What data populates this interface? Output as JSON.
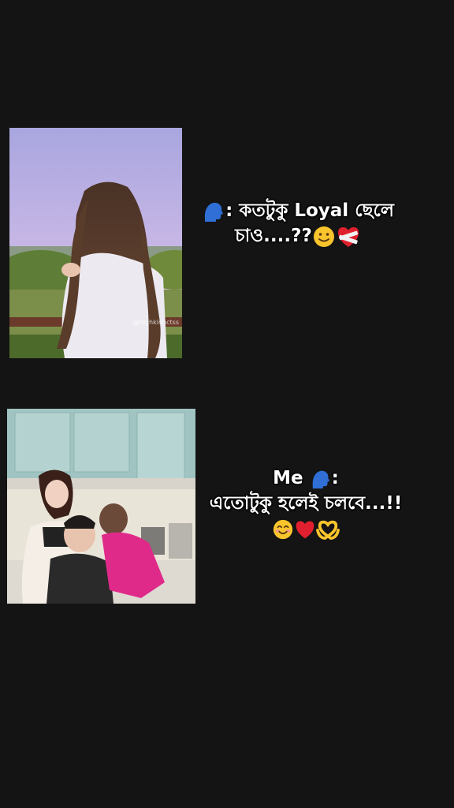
{
  "post": {
    "top": {
      "caption_line1": "কতটুকু Loyal ছেলে",
      "caption_line2": "চাও....??",
      "image_watermark": "@highkinnctss"
    },
    "bottom": {
      "caption_prefix": "Me",
      "caption_line2": "এতোটুকু হলেই চলবে...!!"
    }
  },
  "emoji": {
    "speaking_head": "speaking-head-icon",
    "slight_smile": "slightly-smiling-face-icon",
    "bandaged_heart": "bandaged-heart-icon",
    "smiling_blush": "smiling-face-icon",
    "red_heart": "red-heart-icon",
    "heart_hands": "heart-hands-icon"
  },
  "colors": {
    "background": "#141414",
    "text": "#ffffff",
    "heart": "#e0202e",
    "speaking_head": "#2f6fd6"
  }
}
